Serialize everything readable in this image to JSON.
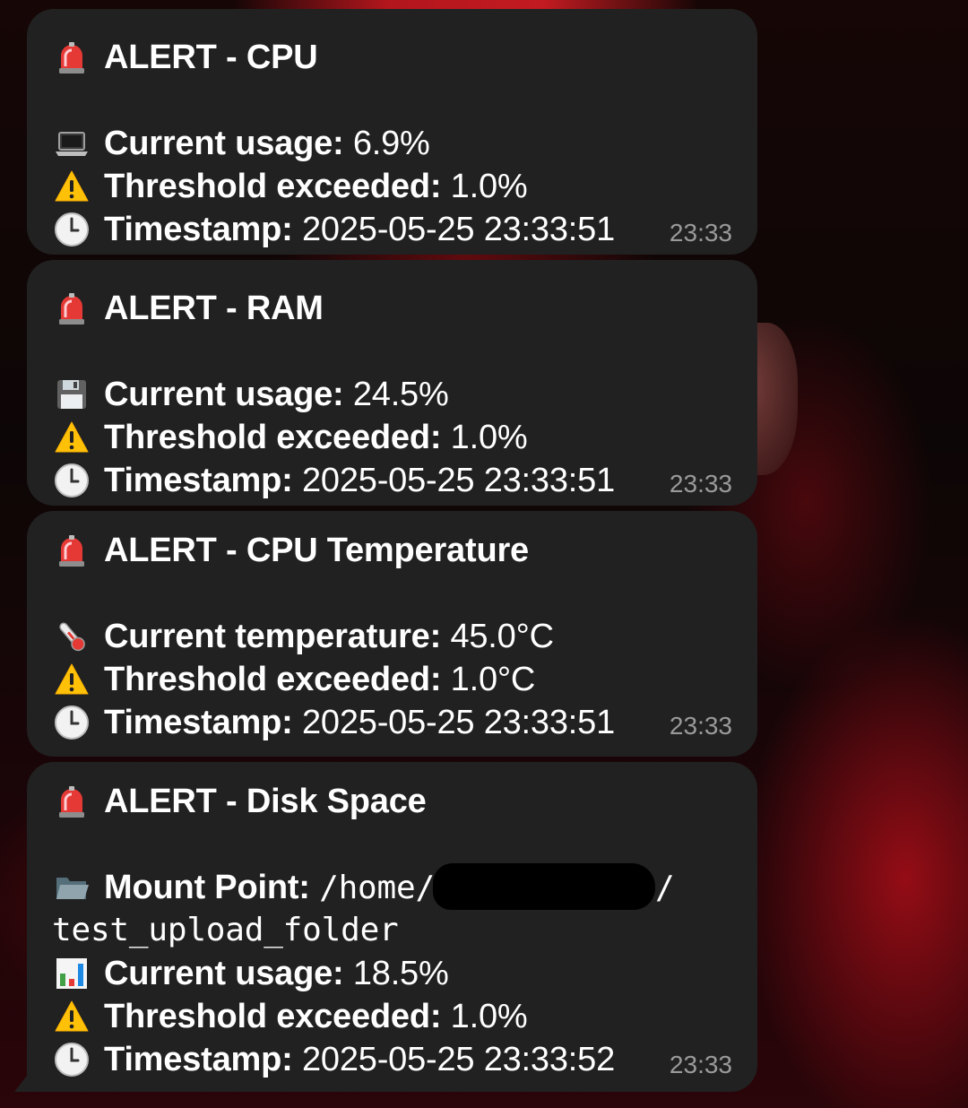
{
  "messages": [
    {
      "title": "ALERT - CPU",
      "lines": [
        {
          "icon": "laptop-icon",
          "label": "Current usage:",
          "value": "6.9%"
        },
        {
          "icon": "warning-icon",
          "label": "Threshold exceeded:",
          "value": "1.0%"
        },
        {
          "icon": "clock-icon",
          "label": "Timestamp:",
          "value": "2025-05-25 23:33:51"
        }
      ],
      "time": "23:33"
    },
    {
      "title": "ALERT - RAM",
      "lines": [
        {
          "icon": "floppy-disk-icon",
          "label": "Current usage:",
          "value": "24.5%"
        },
        {
          "icon": "warning-icon",
          "label": "Threshold exceeded:",
          "value": "1.0%"
        },
        {
          "icon": "clock-icon",
          "label": "Timestamp:",
          "value": "2025-05-25 23:33:51"
        }
      ],
      "time": "23:33"
    },
    {
      "title": "ALERT - CPU Temperature",
      "lines": [
        {
          "icon": "thermometer-icon",
          "label": "Current temperature:",
          "value": "45.0°C"
        },
        {
          "icon": "warning-icon",
          "label": "Threshold exceeded:",
          "value": "1.0°C"
        },
        {
          "icon": "clock-icon",
          "label": "Timestamp:",
          "value": "2025-05-25 23:33:51"
        }
      ],
      "time": "23:33"
    },
    {
      "title": "ALERT - Disk Space",
      "mount": {
        "icon": "folder-icon",
        "label": "Mount Point:",
        "path_start": "/home/",
        "path_end": "/",
        "path_wrap": "test_upload_folder"
      },
      "lines": [
        {
          "icon": "bar-chart-icon",
          "label": "Current usage:",
          "value": "18.5%"
        },
        {
          "icon": "warning-icon",
          "label": "Threshold exceeded:",
          "value": "1.0%"
        },
        {
          "icon": "clock-icon",
          "label": "Timestamp:",
          "value": "2025-05-25 23:33:52"
        }
      ],
      "time": "23:33"
    }
  ],
  "alert_icon": "rotating-light-icon",
  "colors": {
    "bubble": "#212121",
    "time": "#9a9a9a",
    "text": "#ffffff"
  }
}
